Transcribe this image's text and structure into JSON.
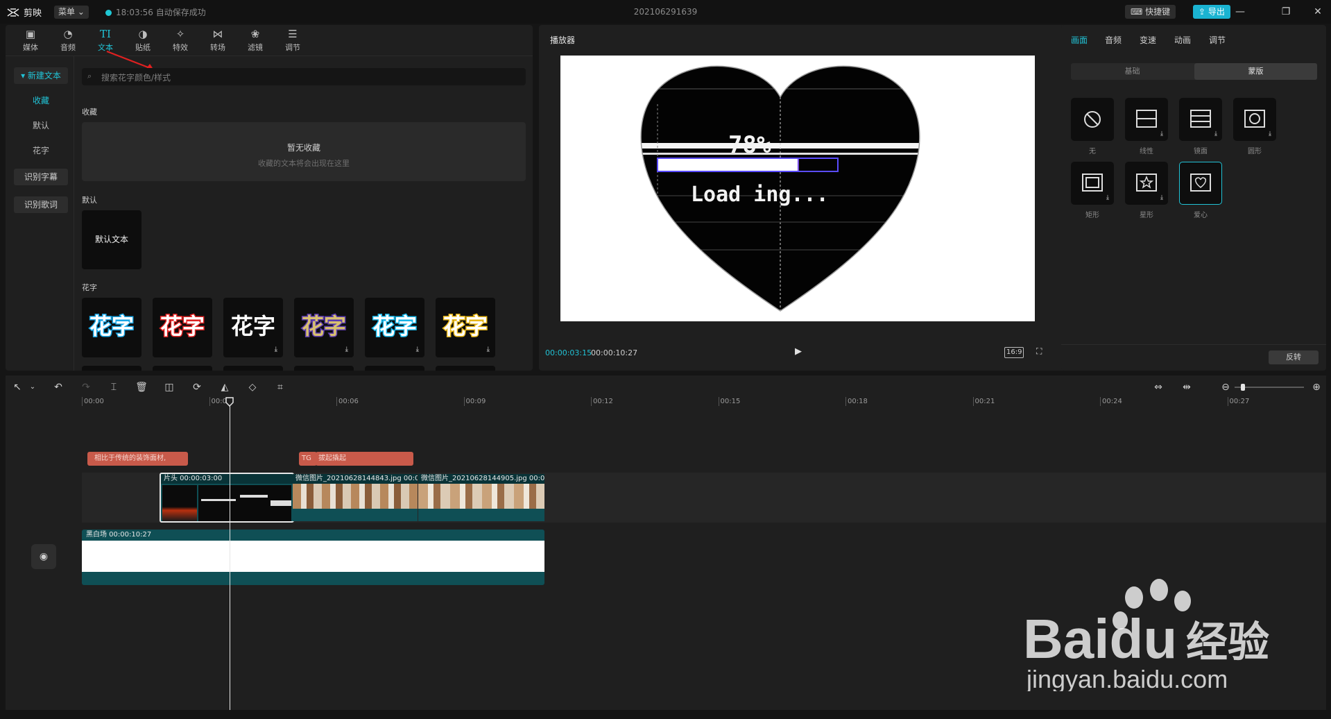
{
  "topbar": {
    "app_name": "剪映",
    "menu_label": "菜单 ⌄",
    "save_status": "18:03:56 自动保存成功",
    "project_title": "202106291639",
    "shortcut_label": "快捷键",
    "export_label": "导出"
  },
  "tool_tabs": [
    {
      "label": "媒体",
      "icon": "media-icon"
    },
    {
      "label": "音频",
      "icon": "audio-icon"
    },
    {
      "label": "文本",
      "icon": "text-icon"
    },
    {
      "label": "贴纸",
      "icon": "sticker-icon"
    },
    {
      "label": "特效",
      "icon": "effects-icon"
    },
    {
      "label": "转场",
      "icon": "transition-icon"
    },
    {
      "label": "滤镜",
      "icon": "filter-icon"
    },
    {
      "label": "调节",
      "icon": "adjust-icon"
    }
  ],
  "left_nav": {
    "new_text": "新建文本",
    "favorites": "收藏",
    "default": "默认",
    "fancy": "花字",
    "recognize_subtitles": "识别字幕",
    "recognize_lyrics": "识别歌词"
  },
  "search": {
    "placeholder": "搜索花字颜色/样式"
  },
  "favorites_section": {
    "label": "收藏",
    "empty_title": "暂无收藏",
    "empty_hint": "收藏的文本将会出现在这里"
  },
  "default_section": {
    "label": "默认",
    "tile_label": "默认文本"
  },
  "fancy_section": {
    "label": "花字",
    "tiles": [
      {
        "text": "花字",
        "color": "#ffffff",
        "stroke": "#1aa7e6"
      },
      {
        "text": "花字",
        "color": "#ffffff",
        "stroke": "#e02222"
      },
      {
        "text": "花字",
        "color": "#ffffff",
        "stroke": "#111111"
      },
      {
        "text": "花字",
        "color": "#d8c070",
        "stroke": "#5a3ab0"
      },
      {
        "text": "花字",
        "color": "#ffffff",
        "stroke": "#18b6e8"
      },
      {
        "text": "花字",
        "color": "#ffffff",
        "stroke": "#e8b718"
      }
    ]
  },
  "player": {
    "title": "播放器",
    "overlay_percent": "78%",
    "overlay_loading": "Load ing...",
    "progress": 0.78,
    "time_current": "00:00:03:15",
    "time_total": "00:00:10:27",
    "ratio_label": "16:9"
  },
  "properties": {
    "tabs": [
      "画面",
      "音频",
      "变速",
      "动画",
      "调节"
    ],
    "segment": [
      "基础",
      "蒙版"
    ],
    "masks": [
      "无",
      "线性",
      "镜面",
      "圆形",
      "矩形",
      "星形",
      "爱心"
    ],
    "reverse_label": "反转"
  },
  "timeline": {
    "ruler": [
      "00:00",
      "00:03",
      "00:06",
      "00:09",
      "00:12",
      "00:15",
      "00:18",
      "00:21",
      "00:24",
      "00:27"
    ],
    "text_clip_1": "相比于传统的装饰面材,",
    "text_clip_2_tag": "TG",
    "text_clip_2": "拔起撬起",
    "video_clips": [
      {
        "label": "片头   00:00:03:00"
      },
      {
        "label": "微信图片_20210628144843.jpg   00:0"
      },
      {
        "label": "微信图片_20210628144905.jpg   00:0"
      }
    ],
    "audio_clip": "黑白场   00:00:10:27"
  },
  "watermark": {
    "brand": "Baidu",
    "suffix": "经验",
    "url": "jingyan.baidu.com"
  },
  "colors": {
    "accent": "#21c3d6",
    "panel": "#1f1f1f",
    "clip_teal": "#0f4f55",
    "clip_red": "#c85a4a"
  }
}
